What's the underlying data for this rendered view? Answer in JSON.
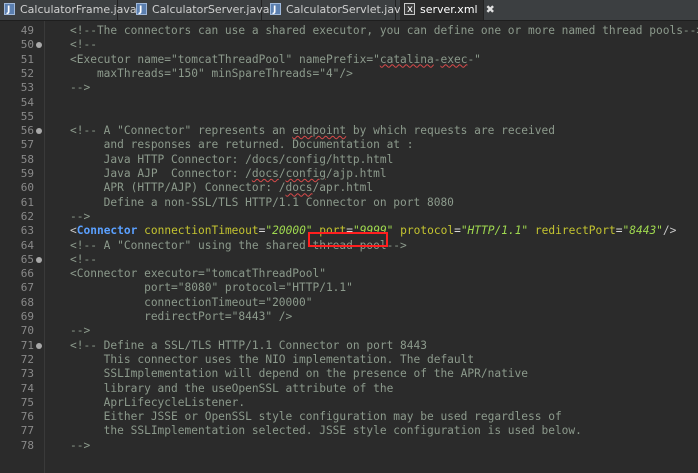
{
  "tabs": [
    {
      "label": "CalculatorFrame.java",
      "icon": "java-file-icon",
      "active": false
    },
    {
      "label": "CalculatorServer.java",
      "icon": "java-file-icon",
      "active": false
    },
    {
      "label": "CalculatorServlet.java",
      "icon": "java-file-icon",
      "active": false
    },
    {
      "label": "server.xml",
      "icon": "xml-file-icon",
      "active": true,
      "close_glyph": "✖"
    }
  ],
  "editor": {
    "lines": [
      {
        "num": "49",
        "text": "<!--The connectors can use a shared executor, you can define one or more named thread pools-->"
      },
      {
        "num": "50",
        "pre": "<!--"
      },
      {
        "num": "51",
        "pre": "<Executor name=\"tomcatThreadPool\" namePrefix=\"",
        "sq": "catalina",
        "mid": "-",
        "sq2": "exec",
        "post": "-\""
      },
      {
        "num": "52",
        "text": "    maxThreads=\"150\" minSpareThreads=\"4\"/>"
      },
      {
        "num": "53",
        "text": "-->"
      },
      {
        "num": "54",
        "text": ""
      },
      {
        "num": "55",
        "text": ""
      },
      {
        "num": "56",
        "pre": "<!-- A \"Connector\" represents an ",
        "sq": "endpoint",
        "post": " by which requests are received"
      },
      {
        "num": "57",
        "text": "     and responses are returned. Documentation at :"
      },
      {
        "num": "58",
        "text": "     Java HTTP Connector: /docs/config/http.html"
      },
      {
        "num": "59",
        "pre": "     Java AJP  Connector: /",
        "sq": "docs",
        "mid": "/",
        "sq2": "config",
        "post": "/ajp.html"
      },
      {
        "num": "60",
        "pre": "     APR (HTTP/AJP) Connector: /",
        "sq": "docs",
        "post": "/apr.html"
      },
      {
        "num": "61",
        "text": "     Define a non-SSL/TLS HTTP/1.1 Connector on port 8080"
      },
      {
        "num": "62",
        "text": "-->"
      },
      {
        "num": "63",
        "connector": true
      },
      {
        "num": "64",
        "text": "<!-- A \"Connector\" using the shared thread pool-->"
      },
      {
        "num": "65",
        "text": "<!--"
      },
      {
        "num": "66",
        "text": "<Connector executor=\"tomcatThreadPool\""
      },
      {
        "num": "67",
        "text": "           port=\"8080\" protocol=\"HTTP/1.1\""
      },
      {
        "num": "68",
        "text": "           connectionTimeout=\"20000\""
      },
      {
        "num": "69",
        "text": "           redirectPort=\"8443\" />"
      },
      {
        "num": "70",
        "text": "-->"
      },
      {
        "num": "71",
        "text": "<!-- Define a SSL/TLS HTTP/1.1 Connector on port 8443"
      },
      {
        "num": "72",
        "text": "     This connector uses the NIO implementation. The default"
      },
      {
        "num": "73",
        "text": "     SSLImplementation will depend on the presence of the APR/native"
      },
      {
        "num": "74",
        "text": "     library and the useOpenSSL attribute of the"
      },
      {
        "num": "75",
        "text": "     AprLifecycleListener."
      },
      {
        "num": "76",
        "text": "     Either JSSE or OpenSSL style configuration may be used regardless of"
      },
      {
        "num": "77",
        "text": "     the SSLImplementation selected. JSSE style configuration is used below."
      },
      {
        "num": "78",
        "text": "-->"
      }
    ],
    "fold_markers": [
      "50",
      "56",
      "65",
      "71"
    ],
    "connector_line": {
      "open": "<",
      "tag": "Connector",
      "attrs": [
        {
          "name": "connectionTimeout",
          "value": "\"20000\""
        },
        {
          "name": "port",
          "value": "\"9999\""
        },
        {
          "name": "protocol",
          "value": "\"HTTP/1.1\""
        },
        {
          "name": "redirectPort",
          "value": "\"8443\""
        }
      ],
      "close": "/>"
    }
  },
  "colors": {
    "background": "#2b2b2b",
    "comment": "#8c9a8c",
    "tag": "#5aa0ff",
    "attribute": "#c4c430",
    "value": "#9fd94f",
    "highlight_box": "#ff1f1f"
  }
}
